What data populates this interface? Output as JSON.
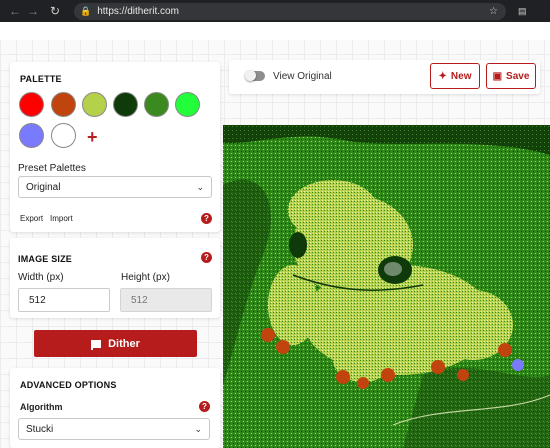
{
  "browser": {
    "url": "https://ditherit.com",
    "back_icon": "arrow-left-icon",
    "forward_icon": "arrow-right-icon",
    "reload_icon": "reload-icon"
  },
  "toolbar": {
    "toggle_label": "View Original",
    "new_label": "New",
    "save_label": "Save",
    "toggle_on": false
  },
  "palette": {
    "title": "PALETTE",
    "colors": [
      "#ff0000",
      "#c1440e",
      "#b5d04a",
      "#0f3b0a",
      "#3a8a1f",
      "#22ff3a",
      "#7a7aff",
      "#ffffff"
    ],
    "add_label": "+",
    "preset_label": "Preset Palettes",
    "preset_value": "Original",
    "export_label": "Export",
    "import_label": "Import",
    "help_label": "?"
  },
  "image_size": {
    "title": "IMAGE SIZE",
    "width_label": "Width (px)",
    "height_label": "Height (px)",
    "width_value": "512",
    "height_value": "512",
    "help_label": "?"
  },
  "dither": {
    "label": "Dither"
  },
  "advanced": {
    "title": "ADVANCED OPTIONS",
    "algorithm_label": "Algorithm",
    "algorithm_value": "Stucki",
    "help_label": "?"
  },
  "theme": {
    "accent": "#b71c1c"
  }
}
